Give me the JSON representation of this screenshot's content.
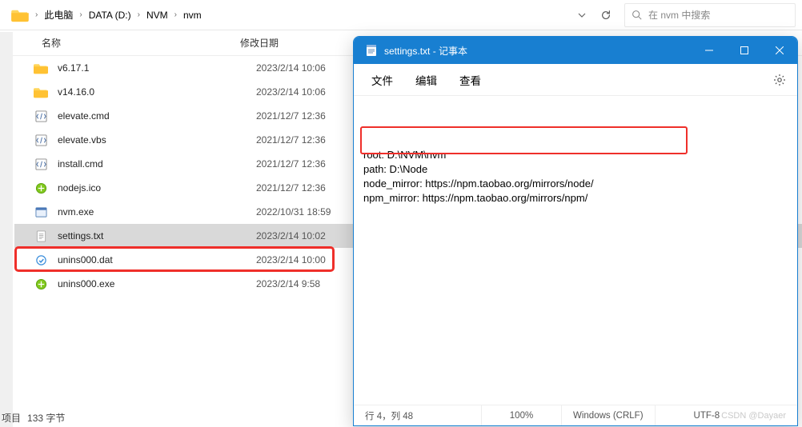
{
  "breadcrumbs": [
    "此电脑",
    "DATA (D:)",
    "NVM",
    "nvm"
  ],
  "search_placeholder": "在 nvm 中搜索",
  "columns": {
    "name": "名称",
    "date": "修改日期"
  },
  "files": [
    {
      "icon": "folder",
      "name": "v6.17.1",
      "date": "2023/2/14 10:06"
    },
    {
      "icon": "folder",
      "name": "v14.16.0",
      "date": "2023/2/14 10:06"
    },
    {
      "icon": "script",
      "name": "elevate.cmd",
      "date": "2021/12/7 12:36"
    },
    {
      "icon": "script",
      "name": "elevate.vbs",
      "date": "2021/12/7 12:36"
    },
    {
      "icon": "script",
      "name": "install.cmd",
      "date": "2021/12/7 12:36"
    },
    {
      "icon": "ico",
      "name": "nodejs.ico",
      "date": "2021/12/7 12:36"
    },
    {
      "icon": "exe",
      "name": "nvm.exe",
      "date": "2022/10/31 18:59"
    },
    {
      "icon": "txt",
      "name": "settings.txt",
      "date": "2023/2/14 10:02",
      "selected": true,
      "highlighted": true
    },
    {
      "icon": "dat",
      "name": "unins000.dat",
      "date": "2023/2/14 10:00"
    },
    {
      "icon": "ico",
      "name": "unins000.exe",
      "date": "2023/2/14 9:58"
    }
  ],
  "status": {
    "items": "项目",
    "detail": "133 字节"
  },
  "notepad": {
    "title": "settings.txt - 记事本",
    "menus": [
      "文件",
      "编辑",
      "查看"
    ],
    "lines": [
      "root: D:\\NVM\\nvm",
      "path: D:\\Node",
      "node_mirror: https://npm.taobao.org/mirrors/node/",
      "npm_mirror: https://npm.taobao.org/mirrors/npm/"
    ],
    "status": {
      "position": "行 4，列 48",
      "zoom": "100%",
      "eol": "Windows (CRLF)",
      "encoding": "UTF-8"
    },
    "watermark": "CSDN @Dayaer"
  }
}
